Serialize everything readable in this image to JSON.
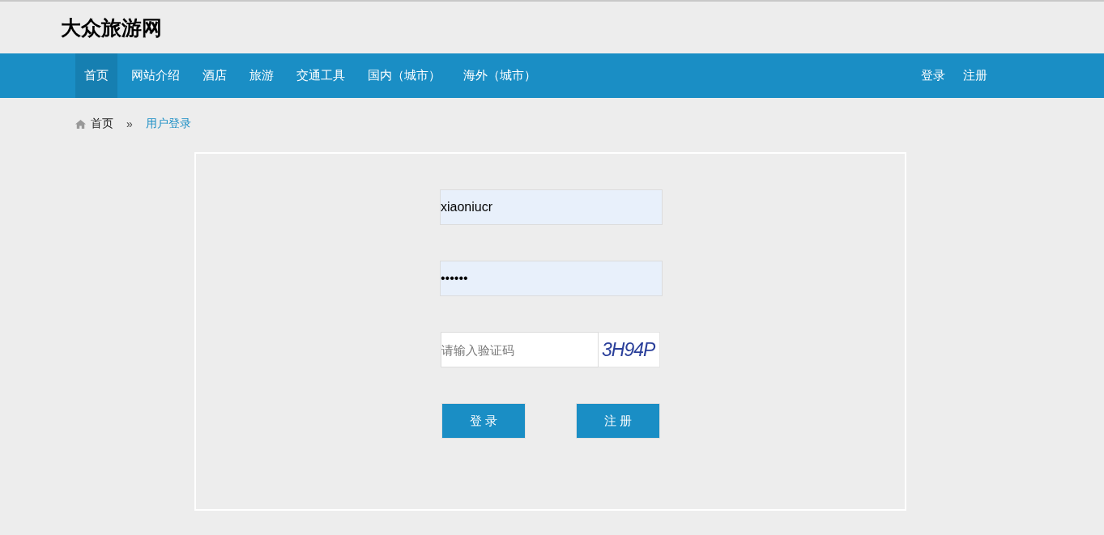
{
  "site_title": "大众旅游网",
  "nav": {
    "items": [
      {
        "label": "首页",
        "selected": true
      },
      {
        "label": "网站介绍",
        "selected": false
      },
      {
        "label": "酒店",
        "selected": false
      },
      {
        "label": "旅游",
        "selected": false
      },
      {
        "label": "交通工具",
        "selected": false
      },
      {
        "label": "国内（城市）",
        "selected": false
      },
      {
        "label": "海外（城市）",
        "selected": false
      }
    ],
    "account_links": [
      "登录",
      "注册"
    ]
  },
  "breadcrumb": {
    "home": "首页",
    "separator": "»",
    "current": "用户登录"
  },
  "login_form": {
    "username": {
      "value": "xiaoniucr"
    },
    "password": {
      "value": "••••••"
    },
    "captcha": {
      "placeholder": "请输入验证码",
      "code": "3H94P"
    },
    "buttons": [
      "登 录",
      "注 册"
    ]
  }
}
